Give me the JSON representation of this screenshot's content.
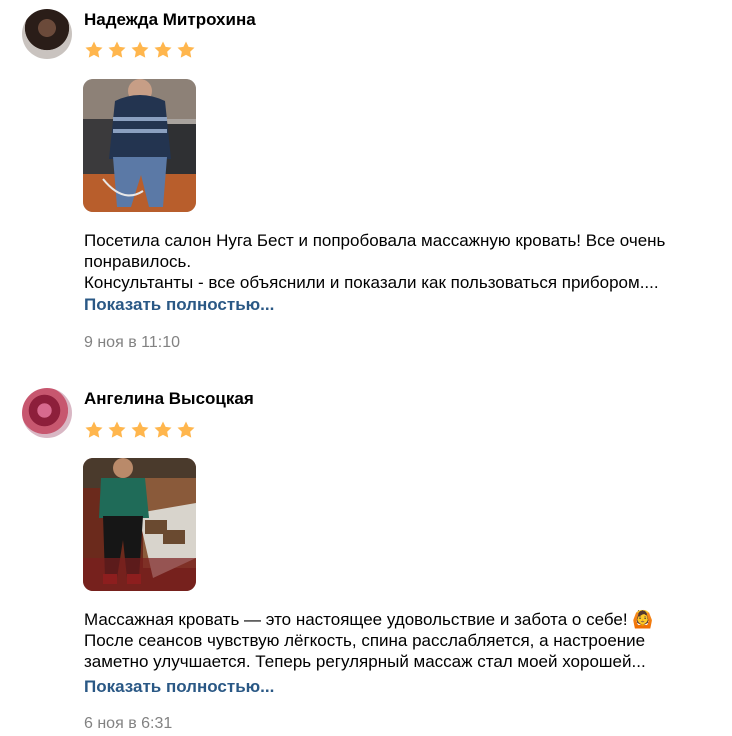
{
  "reviews": [
    {
      "author": "Надежда Митрохина",
      "rating": 5,
      "lines": [
        "Посетила салон Нуга Бест и попробовала массажную кровать! Все очень",
        "понравилось.",
        "Консультанты - все объяснили и показали как пользоваться прибором...."
      ],
      "more_label": "Показать полностью...",
      "date": "9 ноя в 11:10"
    },
    {
      "author": "Ангелина Высоцкая",
      "rating": 5,
      "lines": [
        "Массажная кровать — это настоящее удовольствие и забота о себе! 🙆",
        "После сеансов чувствую лёгкость, спина расслабляется, а настроение",
        "заметно улучшается. Теперь регулярный массаж стал моей хорошей..."
      ],
      "more_label": "Показать полностью...",
      "date": "6 ноя в 6:31"
    }
  ],
  "colors": {
    "star": "#ffb64d",
    "link": "#2a5885",
    "date": "#828282"
  }
}
